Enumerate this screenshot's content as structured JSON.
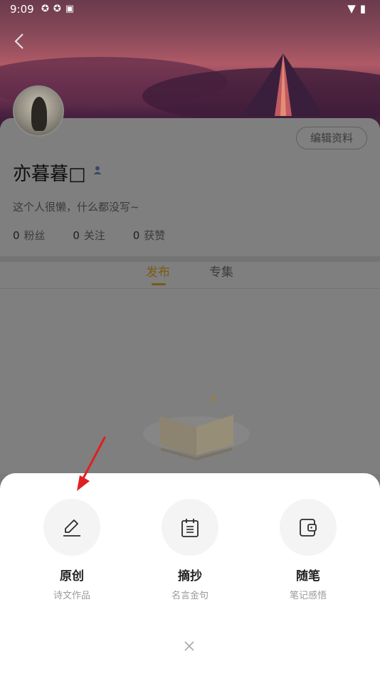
{
  "statusbar": {
    "time": "9:09",
    "left_icons": "✪✪▣",
    "right_icons": "▼▮"
  },
  "profile": {
    "username": "亦暮暮□",
    "bio": "这个人很懒，什么都没写~",
    "edit_label": "编辑资料",
    "stats": [
      {
        "num": "0",
        "label": "粉丝"
      },
      {
        "num": "0",
        "label": "关注"
      },
      {
        "num": "0",
        "label": "获赞"
      }
    ]
  },
  "tabs": {
    "publish": "发布",
    "collection": "专集"
  },
  "sheet": {
    "options": [
      {
        "title": "原创",
        "subtitle": "诗文作品",
        "icon": "pencil-icon"
      },
      {
        "title": "摘抄",
        "subtitle": "名言金句",
        "icon": "notepad-icon"
      },
      {
        "title": "随笔",
        "subtitle": "笔记感悟",
        "icon": "wallet-icon"
      }
    ],
    "close_icon": "close-icon"
  },
  "colors": {
    "accent": "#c8962a",
    "annotation_arrow": "#e02020"
  }
}
